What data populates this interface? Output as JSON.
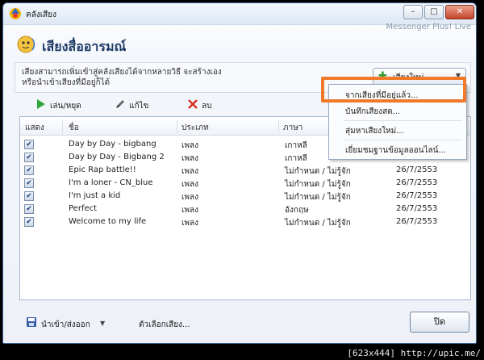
{
  "window": {
    "title": "คลังเสียง",
    "brand": "Messenger Plus! Live",
    "controls": {
      "minimize": "–",
      "maximize": "□",
      "close": "✕"
    }
  },
  "header": {
    "title": "เสียงสื่ออารมณ์"
  },
  "info": {
    "line1": "เสียงสามารถเพิ่มเข้าสู่คลังเสียงได้จากหลายวิธี จะสร้างเอง",
    "line2": "หรือนำเข้าเสียงที่มีอยู่ก็ได้"
  },
  "new_sound_button": {
    "label": "เสียงใหม่"
  },
  "toolbar": {
    "play_label": "เล่น/หยุด",
    "edit_label": "แก้ไข",
    "delete_label": "ลบ"
  },
  "list": {
    "columns": [
      "แสดง",
      "ชื่อ",
      "ประเภท",
      "ภาษา",
      ""
    ],
    "rows": [
      {
        "checked": true,
        "name": "Day by Day - bigbang",
        "type": "เพลง",
        "language": "เกาหลี",
        "date": ""
      },
      {
        "checked": true,
        "name": "Day by Day - Bigbang 2",
        "type": "เพลง",
        "language": "เกาหลี",
        "date": ""
      },
      {
        "checked": true,
        "name": "Epic Rap battle!!",
        "type": "เพลง",
        "language": "ไม่กำหนด / ไม่รู้จัก",
        "date": "26/7/2553"
      },
      {
        "checked": true,
        "name": "I'm a loner - CN_blue",
        "type": "เพลง",
        "language": "ไม่กำหนด / ไม่รู้จัก",
        "date": "26/7/2553"
      },
      {
        "checked": true,
        "name": "I'm just a kid",
        "type": "เพลง",
        "language": "ไม่กำหนด / ไม่รู้จัก",
        "date": "26/7/2553"
      },
      {
        "checked": true,
        "name": "Perfect",
        "type": "เพลง",
        "language": "อังกฤษ",
        "date": "26/7/2553"
      },
      {
        "checked": true,
        "name": "Welcome to my life",
        "type": "เพลง",
        "language": "ไม่กำหนด / ไม่รู้จัก",
        "date": "26/7/2553"
      }
    ]
  },
  "dropdown": {
    "items": [
      "จากเสียงที่มีอยู่แล้ว...",
      "บันทึกเสียงสด...",
      "สุ่มหาเสียงใหม่...",
      "เยี่ยมชมฐานข้อมูลออนไลน์..."
    ]
  },
  "footer": {
    "import_export": "นำเข้า/ส่งออก",
    "options": "ตัวเลือกเสียง...",
    "close": "ปิด"
  },
  "watermark": "[623x444] http://upic.me/",
  "colors": {
    "highlight": "#f07a2a",
    "title": "#1f3a66"
  }
}
